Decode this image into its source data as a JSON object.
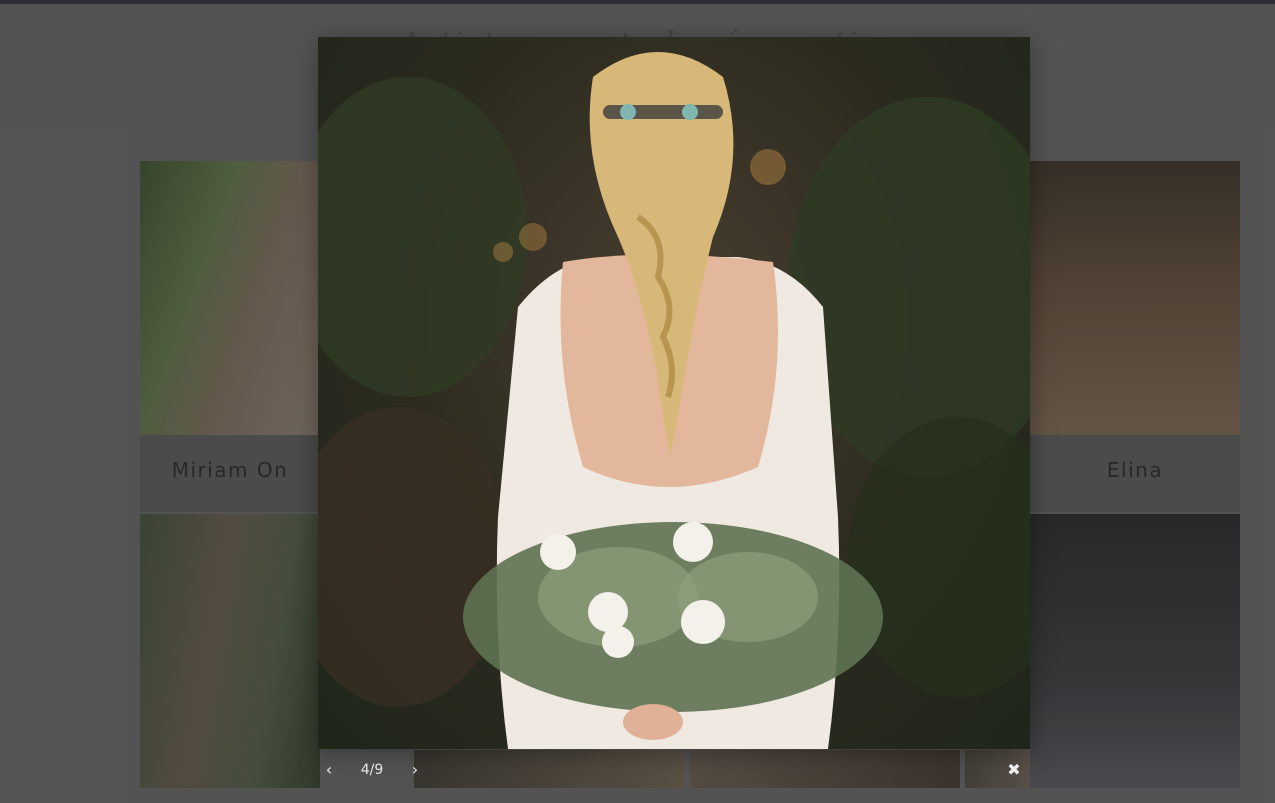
{
  "page": {
    "title": "Artistas que te harán sentir"
  },
  "gallery": {
    "cards": [
      {
        "name": "Miriam On",
        "photo": "bride-white-blazer"
      },
      {
        "name": "Elina",
        "photo": "bride-back-bouquet"
      },
      {
        "name": "",
        "photo": "bride-smiling-portrait"
      },
      {
        "name": "",
        "photo": "bride-profile-headpiece"
      }
    ]
  },
  "lightbox": {
    "image_description": "bride-back-braid-bouquet",
    "counter": "4/9",
    "prev_icon": "chevron-left-icon",
    "next_icon": "chevron-right-icon",
    "close_icon": "close-icon"
  },
  "colors": {
    "page_background": "#5b5b5b",
    "topbar": "#2e3237",
    "card_name_text": "#2b2b2b",
    "controls_text": "#eeeeee"
  }
}
